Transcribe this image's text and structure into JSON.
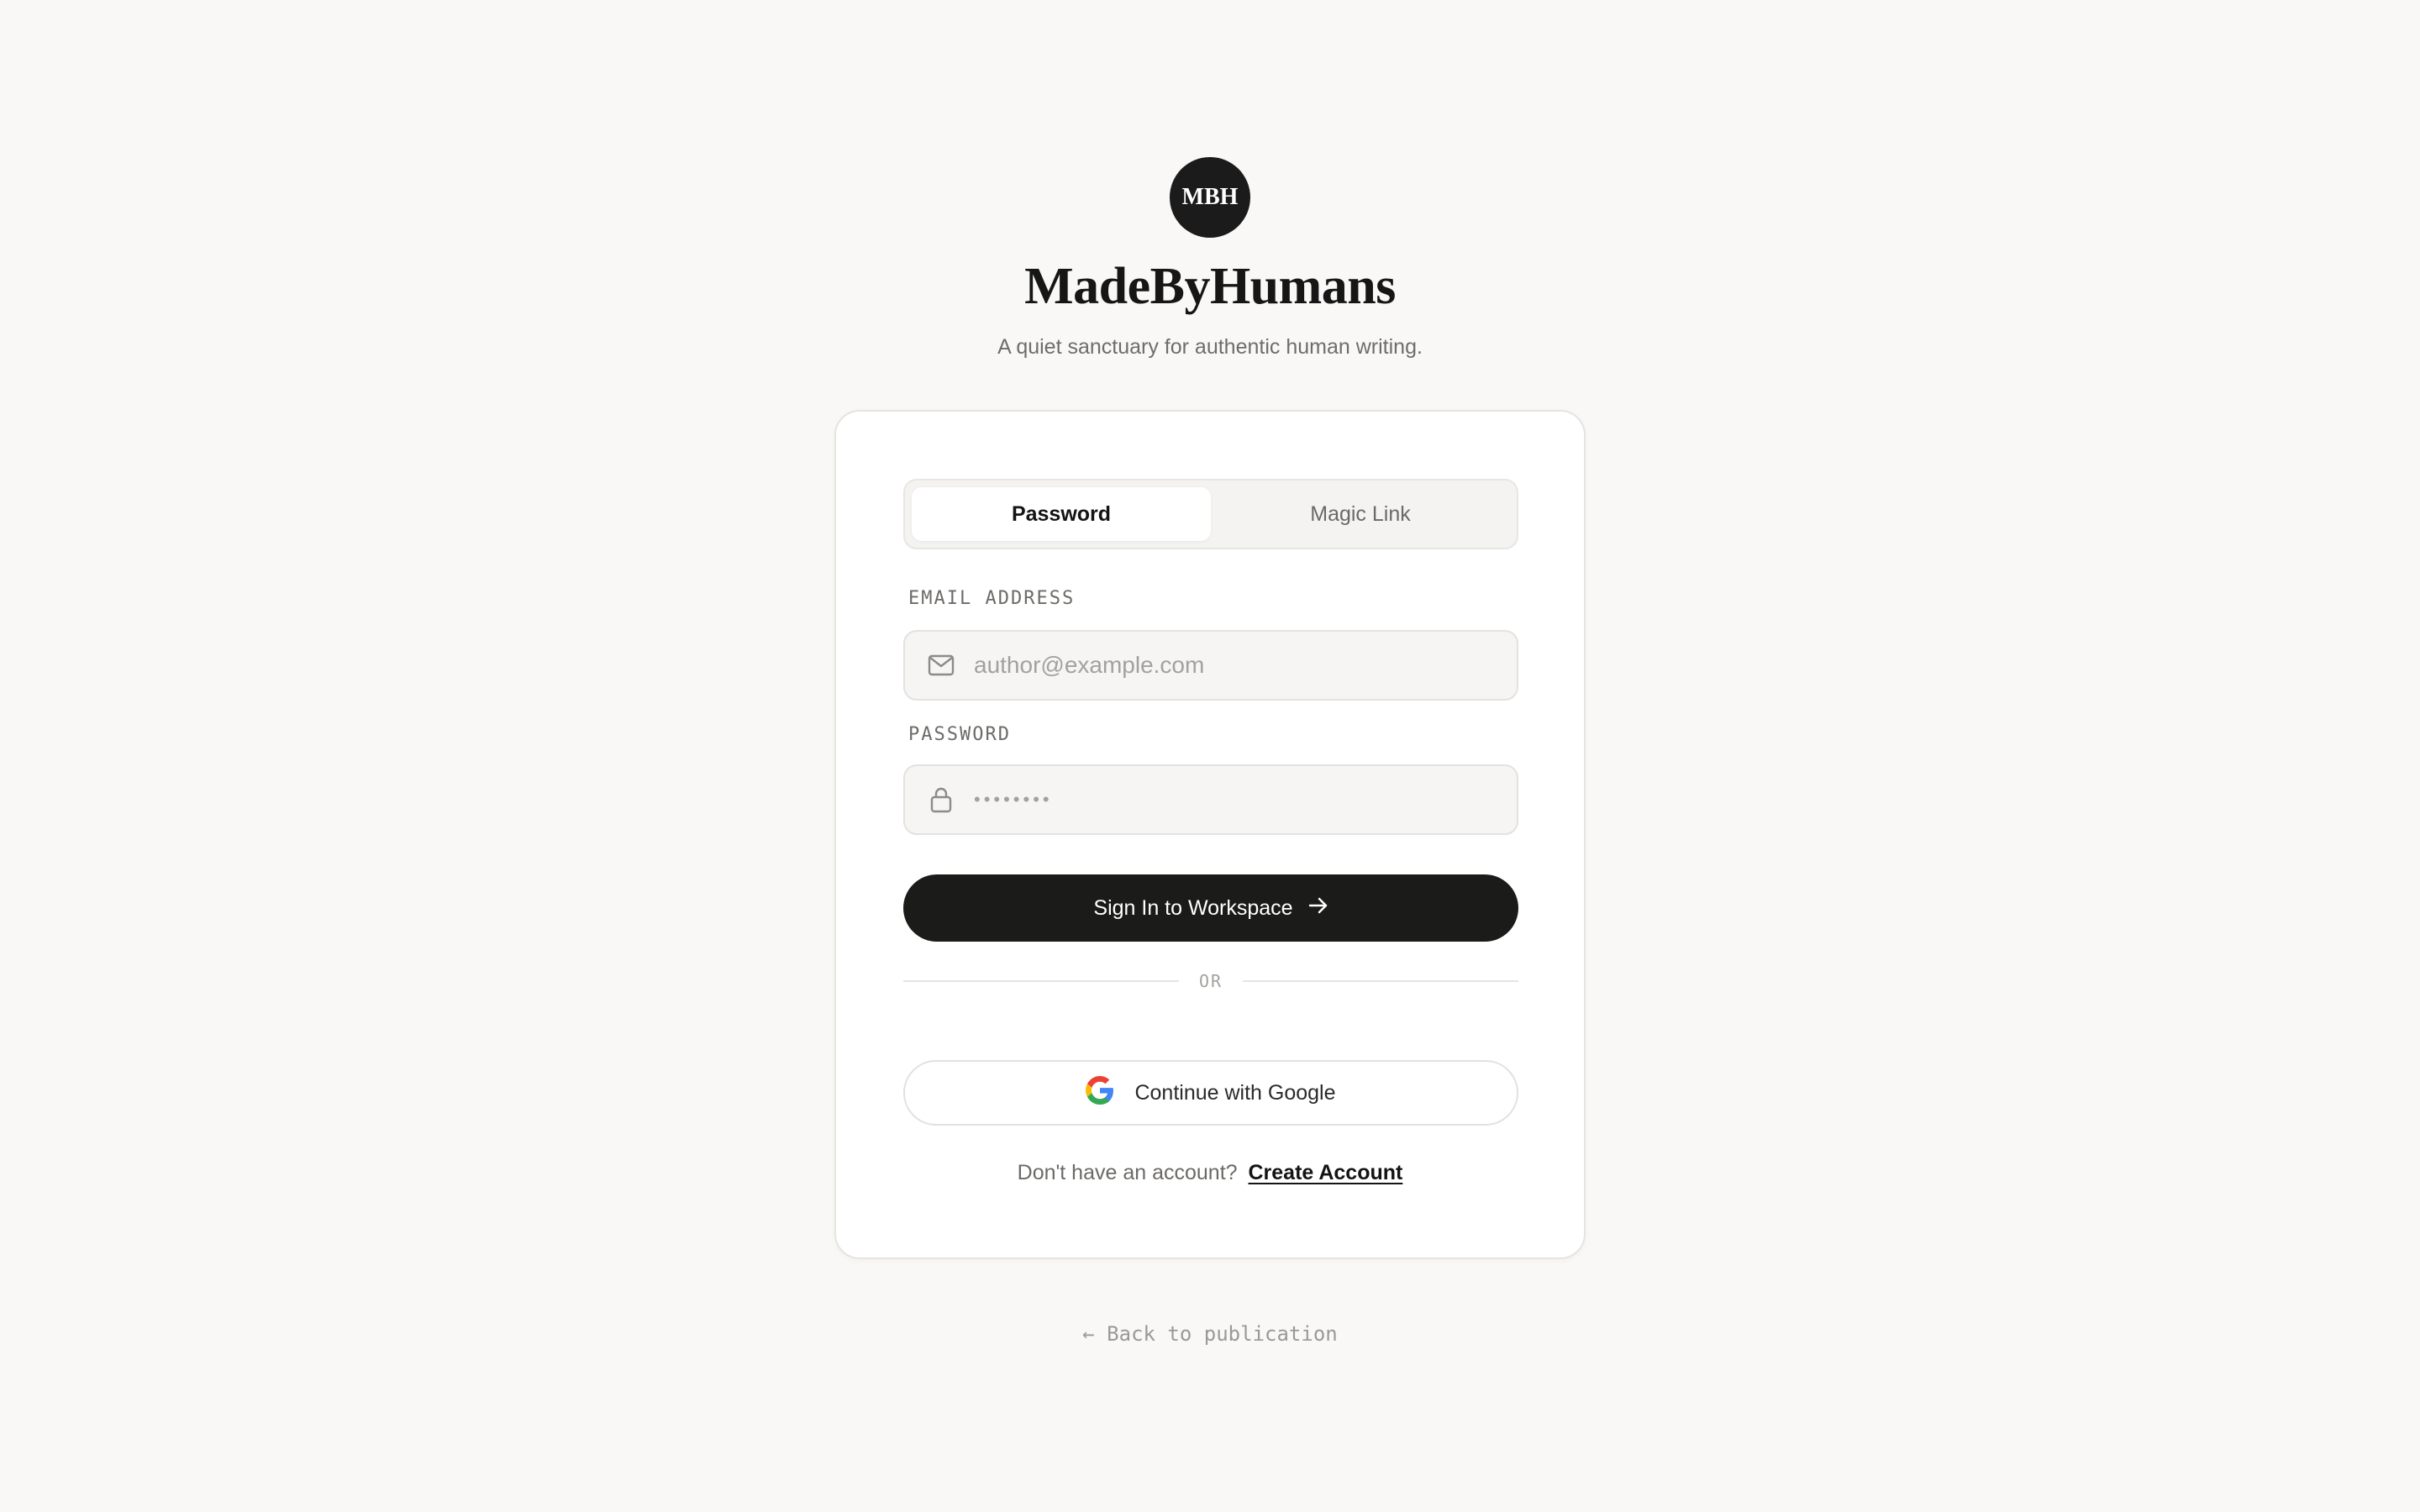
{
  "brand": {
    "logo_text": "MBH",
    "title": "MadeByHumans",
    "tagline": "A quiet sanctuary for authentic human writing."
  },
  "tabs": [
    {
      "label": "Password",
      "active": true
    },
    {
      "label": "Magic Link",
      "active": false
    }
  ],
  "form": {
    "email_label": "EMAIL ADDRESS",
    "email_placeholder": "author@example.com",
    "email_icon": "mail-icon",
    "password_label": "PASSWORD",
    "password_placeholder": "••••••••",
    "password_icon": "lock-icon",
    "submit_label": "Sign In to Workspace",
    "submit_icon": "arrow-right-icon"
  },
  "divider_text": "OR",
  "google": {
    "label": "Continue with Google",
    "icon": "google-icon"
  },
  "signup": {
    "prompt": "Don't have an account?",
    "link_label": "Create Account"
  },
  "back_link": "← Back to publication",
  "colors": {
    "background": "#f9f8f6",
    "primary": "#1b1b19",
    "card": "#ffffff"
  }
}
